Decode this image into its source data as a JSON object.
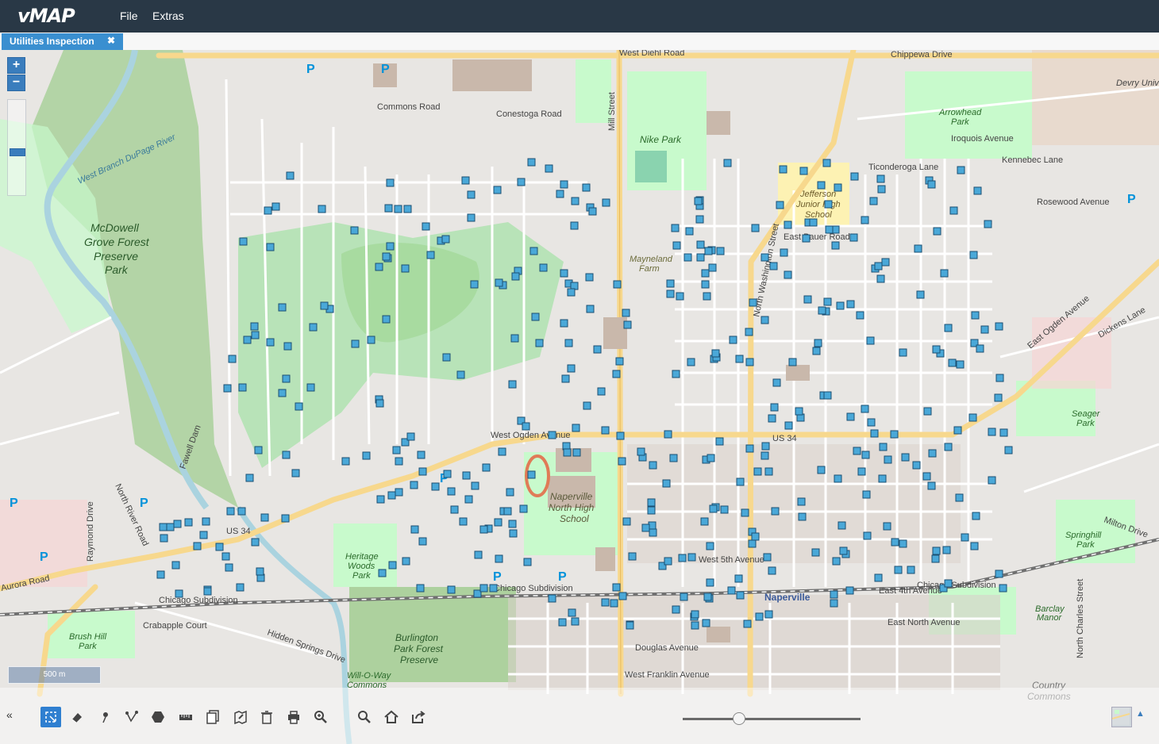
{
  "app": {
    "title": "vMAP"
  },
  "menu": {
    "file": "File",
    "extras": "Extras"
  },
  "tab": {
    "label": "Utilities Inspection",
    "close": "✖"
  },
  "map": {
    "zoom_in": "+",
    "zoom_out": "−",
    "scale": "500 m",
    "labels": {
      "west_diehl_road": "West Diehl Road",
      "mill_street": "Mill Street",
      "nike_park": "Nike Park",
      "commons_road": "Commons Road",
      "conestoga_road": "Conestoga Road",
      "mcdowell_1": "McDowell",
      "mcdowell_2": "Grove Forest",
      "mcdowell_3": "Preserve",
      "mcdowell_4": "Park",
      "jefferson_1": "Jefferson",
      "jefferson_2": "Junior High",
      "jefferson_3": "School",
      "arrowhead_1": "Arrowhead",
      "arrowhead_2": "Park",
      "north_washington": "North Washington Street",
      "east_ogden_avenue": "East Ogden Avenue",
      "west_ogden_avenue": "West Ogden Avenue",
      "us34": "US 34",
      "us34_west": "US 34",
      "naperville_hs_1": "Naperville",
      "naperville_hs_2": "North High",
      "naperville_hs_3": "School",
      "heritage_1": "Heritage",
      "heritage_2": "Woods",
      "heritage_3": "Park",
      "burlington_1": "Burlington",
      "burlington_2": "Park Forest",
      "burlington_3": "Preserve",
      "naperville_town": "Naperville",
      "chicago_subdivision_w": "Chicago Subdivision",
      "chicago_subdivision_c": "Chicago Subdivision",
      "chicago_subdivision_e": "Chicago Subdivision",
      "aurora_road": "Aurora Road",
      "seager_1": "Seager",
      "seager_2": "Park",
      "springhill_1": "Springhill",
      "springhill_2": "Park",
      "barclay_1": "Barclay",
      "barclay_2": "Manor",
      "country_commons_1": "Country",
      "country_commons_2": "Commons",
      "brush_hill_1": "Brush Hill",
      "brush_hill_2": "Park",
      "will_o_way_1": "Will-O-Way",
      "will_o_way_2": "Commons",
      "mayneland_1": "Mayneland",
      "mayneland_2": "Farm",
      "devry": "Devry Unive",
      "west_branch": "West Branch DuPage River",
      "fawell_dam": "Fawell Dam",
      "crabapple_court": "Crabapple Court",
      "douglas_avenue": "Douglas Avenue",
      "west_franklin_avenue": "West Franklin Avenue",
      "east_north_avenue": "East North Avenue",
      "east_4th_avenue": "East 4th Avenue",
      "west_5th_avenue": "West 5th Avenue",
      "east_bauer_road": "East Bauer Road",
      "chippewa_drive": "Chippewa Drive",
      "kennebec_lane": "Kennebec Lane",
      "iroquois_avenue": "Iroquois Avenue",
      "ticonderoga_lane": "Ticonderoga Lane",
      "rosewood_avenue": "Rosewood Avenue",
      "dickens_lane": "Dickens Lane",
      "north_river_road": "North River Road",
      "raymond_drive": "Raymond Drive",
      "hidden_springs_drive": "Hidden Springs Drive",
      "milton_drive": "Milton Drive",
      "north_charles_street": "North Charles Street",
      "parking": "P"
    }
  },
  "toolbar": {
    "left_toggle": "«",
    "tools": [
      "select-tool",
      "erase-tool",
      "point-tool",
      "line-tool",
      "polygon-tool",
      "measure-tool",
      "copy-tool",
      "edit-area-tool",
      "delete-tool",
      "print-tool",
      "zoom-tool",
      "search-tool",
      "home-tool",
      "share-tool"
    ],
    "zoom_level": 0.3,
    "panel_toggle": "▲"
  },
  "colors": {
    "header": "#293846",
    "tab": "#3a8fd0",
    "marker_fill": "#4aa8d8",
    "marker_stroke": "#1b4f72",
    "major_road": "#f7d88d",
    "park": "#c8facc",
    "forest": "#add19e"
  }
}
